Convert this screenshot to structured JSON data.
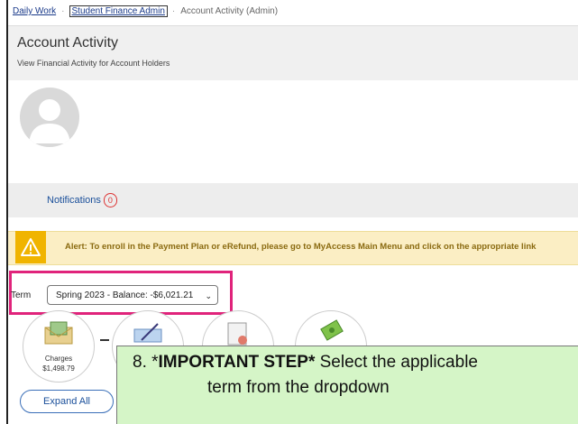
{
  "breadcrumb": {
    "item1": "Daily Work",
    "item2": "Student Finance Admin",
    "item3": "Account Activity (Admin)"
  },
  "header": {
    "title": "Account Activity",
    "subtitle": "View Financial Activity for Account Holders"
  },
  "notifications": {
    "label": "Notifications",
    "count": "0"
  },
  "alert": {
    "prefix": "Alert:",
    "message": "To enroll in the Payment Plan or eRefund, please go to MyAccess Main Menu and click on the appropriate link"
  },
  "term": {
    "label": "Term",
    "selected": "Spring 2023 - Balance: -$6,021.21"
  },
  "summary": {
    "charges_label": "Charges",
    "charges_amount": "$1,498.79",
    "dash": "–"
  },
  "actions": {
    "expand_all": "Expand All"
  },
  "callout": {
    "line1_prefix": "8. *",
    "line1_bold": "IMPORTANT STEP*",
    "line1_rest": " Select the applicable",
    "line2": "term from the dropdown"
  },
  "colors": {
    "highlight": "#e0237b",
    "callout_bg": "#d5f5c7",
    "alert_bg": "#fbeec4",
    "alert_icon": "#f0b400",
    "link": "#1a4f9a"
  }
}
